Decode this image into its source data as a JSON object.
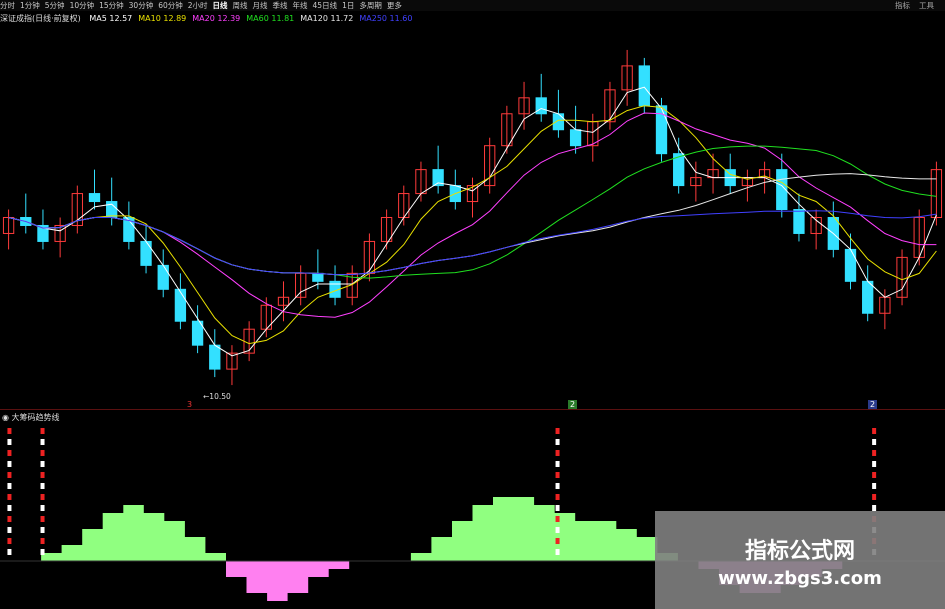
{
  "toolbar": {
    "items": [
      "分时",
      "1分钟",
      "5分钟",
      "10分钟",
      "15分钟",
      "30分钟",
      "60分钟",
      "2小时",
      "日线",
      "周线",
      "月线",
      "季线",
      "年线",
      "45日线",
      "1日",
      "多周期",
      "更多"
    ],
    "active": "日线",
    "right_items": [
      "指标",
      "工具"
    ]
  },
  "ma_bar": {
    "title": "深证成指(日线·前复权)",
    "items": [
      {
        "label": "MA5",
        "value": "12.57",
        "color": "#ffffff"
      },
      {
        "label": "MA10",
        "value": "12.89",
        "color": "#e8e000"
      },
      {
        "label": "MA20",
        "value": "12.39",
        "color": "#ff40ff"
      },
      {
        "label": "MA60",
        "value": "11.81",
        "color": "#20e020"
      },
      {
        "label": "MA120",
        "value": "11.72",
        "color": "#e8e8e8"
      },
      {
        "label": "MA250",
        "value": "11.60",
        "color": "#4040ff"
      }
    ]
  },
  "annotations": {
    "low_price": "10.50",
    "mark_red": "3",
    "mark_1": "2",
    "mark_2": "2"
  },
  "indicator": {
    "title": "大筹码趋势线"
  },
  "watermark": {
    "title": "指标公式网",
    "url": "www.zbgs3.com"
  },
  "colors": {
    "up": "#ff3b3b",
    "down": "#33e0ff",
    "ind_pos": "#90ff80",
    "ind_neg": "#ff80f0"
  },
  "chart_data": [
    {
      "type": "candlestick",
      "ohlc": [
        [
          12.4,
          12.7,
          12.2,
          12.6
        ],
        [
          12.6,
          12.9,
          12.4,
          12.5
        ],
        [
          12.5,
          12.7,
          12.2,
          12.3
        ],
        [
          12.3,
          12.6,
          12.1,
          12.5
        ],
        [
          12.5,
          13.0,
          12.4,
          12.9
        ],
        [
          12.9,
          13.2,
          12.7,
          12.8
        ],
        [
          12.8,
          13.1,
          12.5,
          12.6
        ],
        [
          12.6,
          12.8,
          12.2,
          12.3
        ],
        [
          12.3,
          12.5,
          11.9,
          12.0
        ],
        [
          12.0,
          12.2,
          11.6,
          11.7
        ],
        [
          11.7,
          11.9,
          11.2,
          11.3
        ],
        [
          11.3,
          11.5,
          10.9,
          11.0
        ],
        [
          11.0,
          11.2,
          10.6,
          10.7
        ],
        [
          10.7,
          11.0,
          10.5,
          10.9
        ],
        [
          10.9,
          11.3,
          10.8,
          11.2
        ],
        [
          11.2,
          11.6,
          11.1,
          11.5
        ],
        [
          11.5,
          11.8,
          11.3,
          11.6
        ],
        [
          11.6,
          12.0,
          11.5,
          11.9
        ],
        [
          11.9,
          12.2,
          11.7,
          11.8
        ],
        [
          11.8,
          12.0,
          11.5,
          11.6
        ],
        [
          11.6,
          12.0,
          11.5,
          11.9
        ],
        [
          11.9,
          12.4,
          11.8,
          12.3
        ],
        [
          12.3,
          12.7,
          12.2,
          12.6
        ],
        [
          12.6,
          13.0,
          12.5,
          12.9
        ],
        [
          12.9,
          13.3,
          12.8,
          13.2
        ],
        [
          13.2,
          13.5,
          12.9,
          13.0
        ],
        [
          13.0,
          13.2,
          12.7,
          12.8
        ],
        [
          12.8,
          13.1,
          12.6,
          13.0
        ],
        [
          13.0,
          13.6,
          12.9,
          13.5
        ],
        [
          13.5,
          14.0,
          13.4,
          13.9
        ],
        [
          13.9,
          14.3,
          13.7,
          14.1
        ],
        [
          14.1,
          14.4,
          13.8,
          13.9
        ],
        [
          13.9,
          14.2,
          13.6,
          13.7
        ],
        [
          13.7,
          14.0,
          13.4,
          13.5
        ],
        [
          13.5,
          13.9,
          13.3,
          13.8
        ],
        [
          13.8,
          14.3,
          13.7,
          14.2
        ],
        [
          14.2,
          14.7,
          14.0,
          14.5
        ],
        [
          14.5,
          14.6,
          13.9,
          14.0
        ],
        [
          14.0,
          14.1,
          13.3,
          13.4
        ],
        [
          13.4,
          13.6,
          12.9,
          13.0
        ],
        [
          13.0,
          13.3,
          12.8,
          13.1
        ],
        [
          13.1,
          13.4,
          12.9,
          13.2
        ],
        [
          13.2,
          13.4,
          12.9,
          13.0
        ],
        [
          13.0,
          13.2,
          12.8,
          13.1
        ],
        [
          13.1,
          13.3,
          12.9,
          13.2
        ],
        [
          13.2,
          13.4,
          12.6,
          12.7
        ],
        [
          12.7,
          12.9,
          12.3,
          12.4
        ],
        [
          12.4,
          12.7,
          12.2,
          12.6
        ],
        [
          12.6,
          12.8,
          12.1,
          12.2
        ],
        [
          12.2,
          12.4,
          11.7,
          11.8
        ],
        [
          11.8,
          12.0,
          11.3,
          11.4
        ],
        [
          11.4,
          11.7,
          11.2,
          11.6
        ],
        [
          11.6,
          12.2,
          11.5,
          12.1
        ],
        [
          12.1,
          12.7,
          12.0,
          12.6
        ],
        [
          12.6,
          13.3,
          12.5,
          13.2
        ]
      ]
    },
    {
      "type": "area",
      "series": [
        {
          "name": "pos",
          "values": [
            0,
            0,
            1,
            2,
            4,
            6,
            7,
            6,
            5,
            3,
            1,
            0,
            0,
            0,
            0,
            0,
            0,
            0,
            0,
            0,
            1,
            3,
            5,
            7,
            8,
            8,
            7,
            6,
            5,
            5,
            4,
            3,
            1,
            0,
            0,
            0,
            0,
            0,
            0,
            0,
            0,
            0,
            0,
            0,
            0,
            0
          ]
        },
        {
          "name": "neg",
          "values": [
            0,
            0,
            0,
            0,
            0,
            0,
            0,
            0,
            0,
            0,
            0,
            -2,
            -4,
            -5,
            -4,
            -2,
            -1,
            0,
            0,
            0,
            0,
            0,
            0,
            0,
            0,
            0,
            0,
            0,
            0,
            0,
            0,
            0,
            0,
            0,
            -1,
            -3,
            -4,
            -4,
            -3,
            -2,
            -1,
            0,
            0,
            0,
            0,
            0
          ]
        }
      ],
      "signals_x": [
        0.01,
        0.045,
        0.59,
        0.925
      ]
    }
  ]
}
